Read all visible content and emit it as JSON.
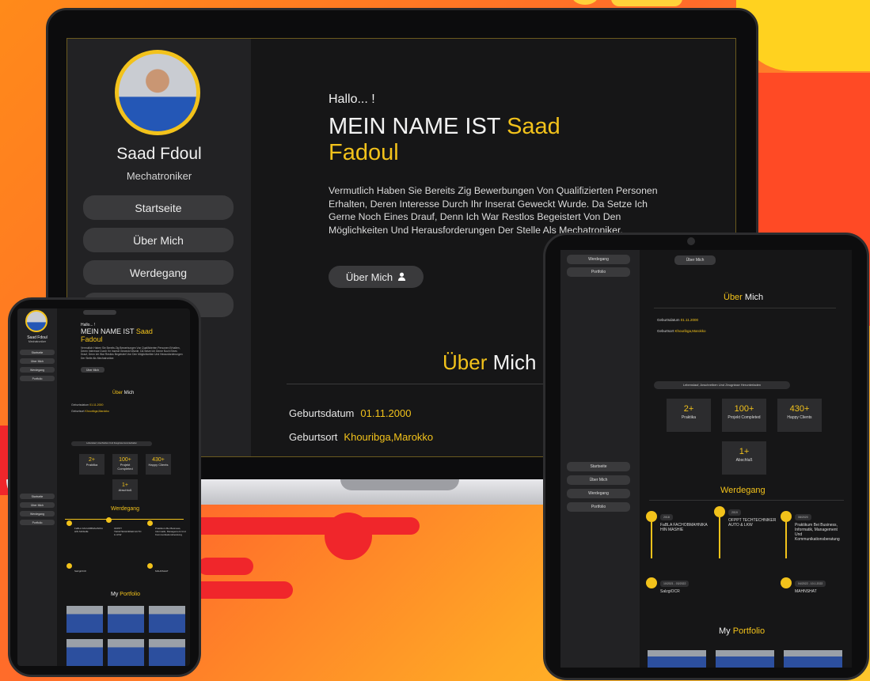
{
  "profile": {
    "name": "Saad Fdoul",
    "role": "Mechatroniker"
  },
  "nav": [
    "Startseite",
    "Über Mich",
    "Werdegang",
    "Portfolio"
  ],
  "hero": {
    "greeting": "Hallo... !",
    "title_prefix": "MEIN NAME IST ",
    "title_name_1": "Saad",
    "title_name_2": "Fadoul",
    "intro": "Vermutlich Haben Sie Bereits Zig Bewerbungen Von Qualifizierten Personen Erhalten, Deren Interesse Durch Ihr Inserat Geweckt Wurde. Da Setze Ich Gerne Noch Eines Drauf, Denn Ich War Restlos Begeistert Von Den Möglichkeiten Und Herausforderungen Der Stelle Als Mechatroniker.",
    "button": "Über Mich"
  },
  "about": {
    "title_1": "Über",
    "title_2": " Mich",
    "rows": [
      {
        "label": "Geburtsdatum",
        "value": "01.11.2000"
      },
      {
        "label": "Geburtsort",
        "value": "Khouribga,Marokko"
      }
    ],
    "docs_button": "Lebenslauf, Anschreiben Und Zeugnisse Herunterladen"
  },
  "stats": [
    {
      "value": "2+",
      "label": "Praktika"
    },
    {
      "value": "100+",
      "label": "Projekt Completed"
    },
    {
      "value": "430+",
      "label": "Happy Clients"
    },
    {
      "value": "1+",
      "label": "Abschluß"
    }
  ],
  "career": {
    "title": "Werdegang",
    "items": [
      {
        "badge": "2018",
        "title": "FaBLA FACHOBMAHNIKA HIN MASHIE"
      },
      {
        "badge": "2019",
        "title": "OFPPT TECHTECHNIKER AUTO & LKW"
      },
      {
        "badge": "08/2020",
        "title": "Praktikum Bei Business, Informatik, Management Und Kommunikationsberatung"
      },
      {
        "badge": "10/2021 - 03/2022",
        "title": "SalzgiOCR"
      },
      {
        "badge": "04/2022 - 10.1.2022",
        "title": "MAHNSHAT"
      }
    ]
  },
  "portfolio": {
    "title_1": "My",
    "title_2": " Portfolio"
  },
  "colors": {
    "accent": "#f2c21b",
    "panel": "#161617",
    "sidebar": "#222224",
    "background_red": "#f0262b"
  }
}
